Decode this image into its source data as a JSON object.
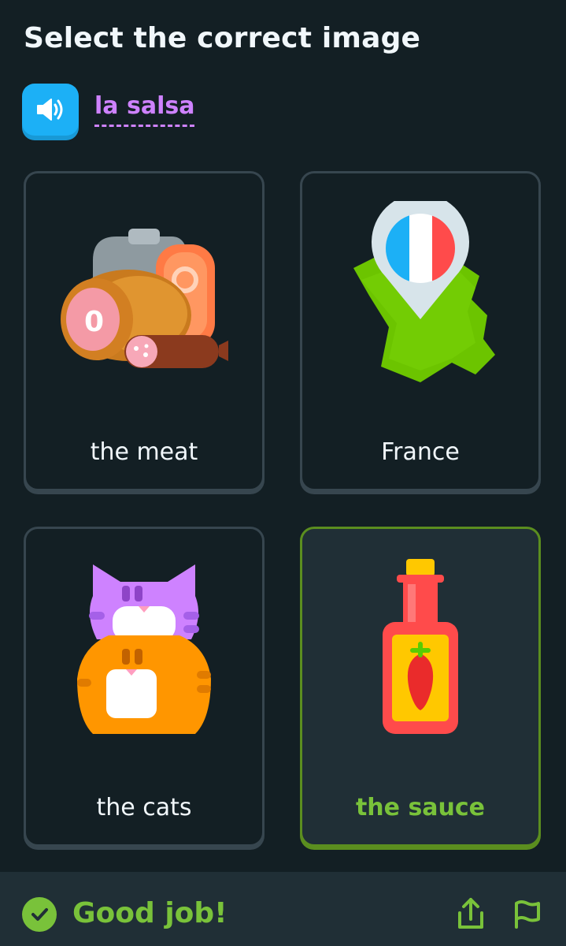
{
  "header": {
    "title": "Select the correct image"
  },
  "prompt": {
    "word": "la salsa",
    "speaker_icon": "speaker-icon"
  },
  "options": [
    {
      "label": "the meat",
      "icon": "meat-illustration",
      "selected": false
    },
    {
      "label": "France",
      "icon": "france-map-illustration",
      "selected": false
    },
    {
      "label": "the cats",
      "icon": "cats-illustration",
      "selected": false
    },
    {
      "label": "the sauce",
      "icon": "hot-sauce-illustration",
      "selected": true
    }
  ],
  "feedback": {
    "message": "Good job!",
    "status_icon": "checkmark-icon",
    "share_icon": "share-icon",
    "report_icon": "flag-icon"
  },
  "colors": {
    "background": "#131F24",
    "accent_correct": "#79C23A",
    "prompt_word": "#CE82FF",
    "speaker_button": "#1CB0F6"
  }
}
